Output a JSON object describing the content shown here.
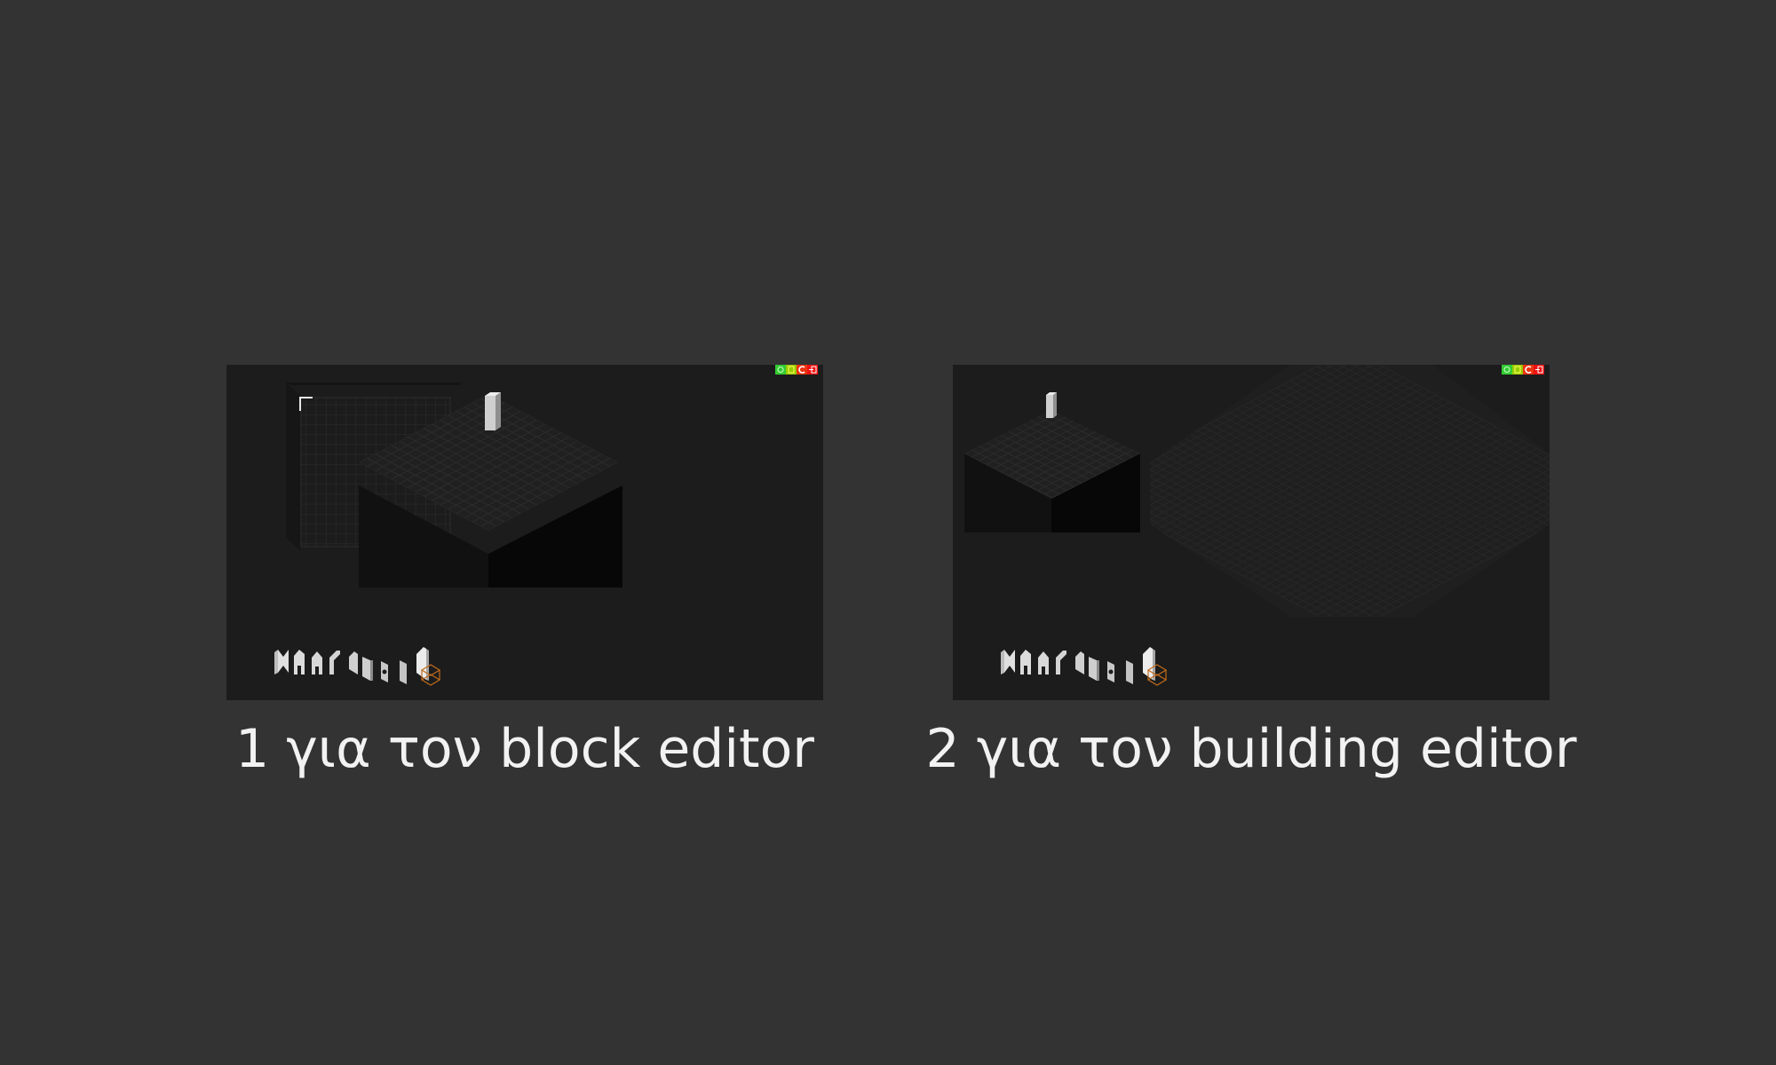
{
  "options": [
    {
      "id": "block",
      "caption": "1 για τον block editor"
    },
    {
      "id": "building",
      "caption": "2 για τον building editor"
    }
  ],
  "toolbar_icons": [
    {
      "name": "settings-icon",
      "color": "#33cc33"
    },
    {
      "name": "save-icon",
      "color": "#99cc00"
    },
    {
      "name": "reload-icon",
      "color": "#ee3311"
    },
    {
      "name": "exit-icon",
      "color": "#ee1111"
    }
  ],
  "colors": {
    "background": "#333333",
    "preview_bg": "#1c1c1c",
    "caption_text": "#f2f2f2"
  }
}
